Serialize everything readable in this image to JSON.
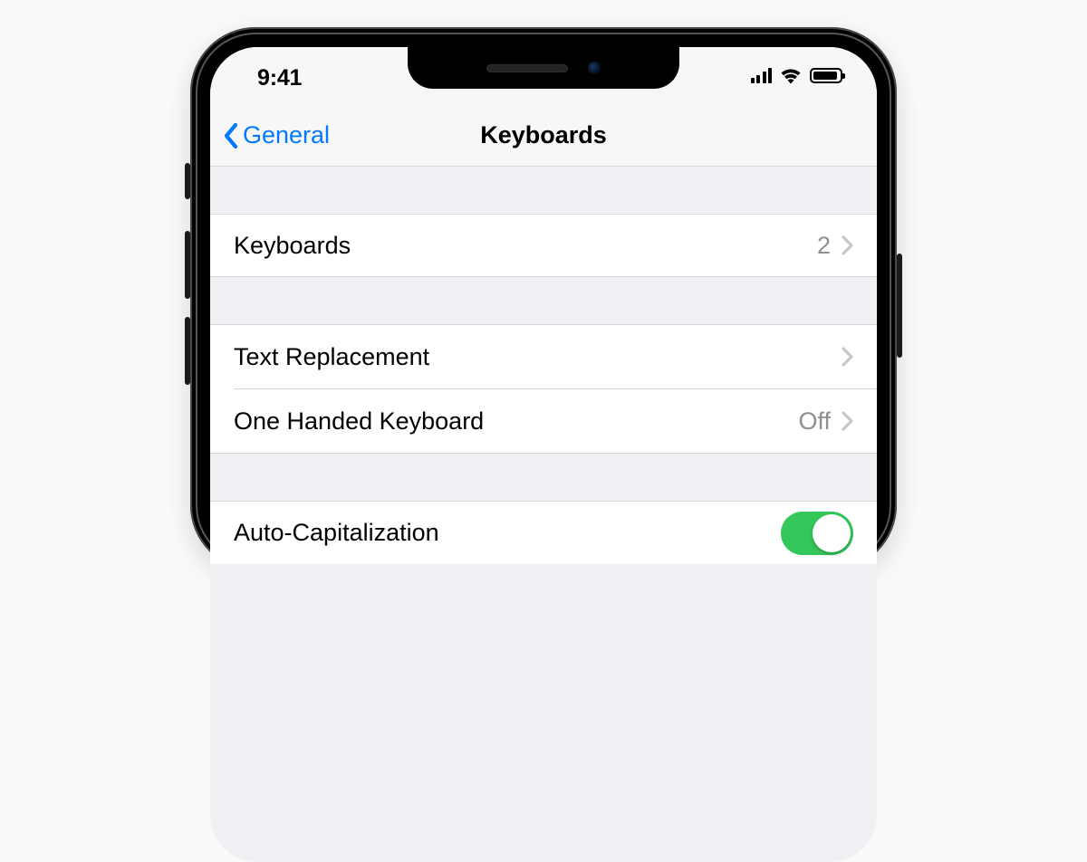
{
  "status": {
    "time": "9:41"
  },
  "nav": {
    "back_label": "General",
    "title": "Keyboards"
  },
  "rows": {
    "keyboards": {
      "label": "Keyboards",
      "value": "2"
    },
    "text_replacement": {
      "label": "Text Replacement"
    },
    "one_handed": {
      "label": "One Handed Keyboard",
      "value": "Off"
    },
    "auto_cap": {
      "label": "Auto-Capitalization",
      "toggle_on": true
    }
  },
  "colors": {
    "tint": "#007aff",
    "toggle_on": "#34c759"
  }
}
